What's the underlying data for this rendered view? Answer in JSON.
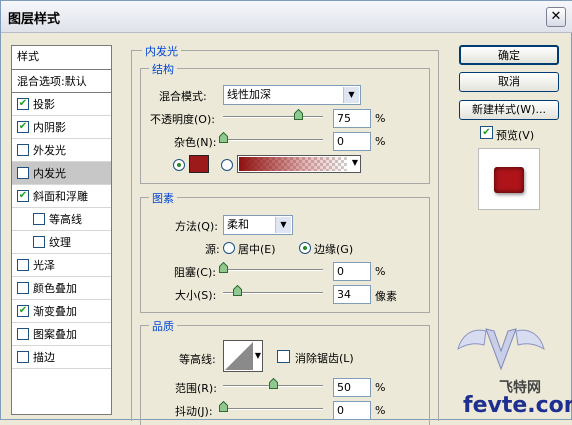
{
  "window": {
    "title": "图层样式",
    "close_glyph": "✕"
  },
  "sidebar": {
    "header": "样式",
    "blend_options": "混合选项:默认",
    "items": [
      {
        "label": "投影",
        "checked": true,
        "indent": 0,
        "selected": false
      },
      {
        "label": "内阴影",
        "checked": true,
        "indent": 0,
        "selected": false
      },
      {
        "label": "外发光",
        "checked": false,
        "indent": 0,
        "selected": false
      },
      {
        "label": "内发光",
        "checked": false,
        "indent": 0,
        "selected": true
      },
      {
        "label": "斜面和浮雕",
        "checked": true,
        "indent": 0,
        "selected": false
      },
      {
        "label": "等高线",
        "checked": false,
        "indent": 1,
        "selected": false
      },
      {
        "label": "纹理",
        "checked": false,
        "indent": 1,
        "selected": false
      },
      {
        "label": "光泽",
        "checked": false,
        "indent": 0,
        "selected": false
      },
      {
        "label": "颜色叠加",
        "checked": false,
        "indent": 0,
        "selected": false
      },
      {
        "label": "渐变叠加",
        "checked": true,
        "indent": 0,
        "selected": false
      },
      {
        "label": "图案叠加",
        "checked": false,
        "indent": 0,
        "selected": false
      },
      {
        "label": "描边",
        "checked": false,
        "indent": 0,
        "selected": false
      }
    ]
  },
  "panel": {
    "title": "内发光",
    "structure": {
      "legend": "结构",
      "blend_mode_label": "混合模式:",
      "blend_mode_value": "线性加深",
      "opacity_label": "不透明度(O):",
      "opacity_value": "75",
      "opacity_level": 0.75,
      "noise_label": "杂色(N):",
      "noise_value": "0",
      "noise_level": 0,
      "percent": "%",
      "color": "#9c1a1a"
    },
    "elements": {
      "legend": "图素",
      "method_label": "方法(Q):",
      "method_value": "柔和",
      "source_label": "源:",
      "source_center": "居中(E)",
      "source_edge": "边缘(G)",
      "source_selected": "edge",
      "choke_label": "阻塞(C):",
      "choke_value": "0",
      "choke_level": 0,
      "size_label": "大小(S):",
      "size_value": "34",
      "size_level": 0.136,
      "pixel_unit": "像素",
      "percent": "%"
    },
    "quality": {
      "legend": "品质",
      "contour_label": "等高线:",
      "anti_alias_label": "消除锯齿(L)",
      "anti_alias_checked": false,
      "range_label": "范围(R):",
      "range_value": "50",
      "range_level": 0.5,
      "jitter_label": "抖动(J):",
      "jitter_value": "0",
      "jitter_level": 0,
      "percent": "%"
    }
  },
  "buttons": {
    "ok": "确定",
    "cancel": "取消",
    "new_style": "新建样式(W)..."
  },
  "preview": {
    "label": "预览(V)",
    "checked": true,
    "swatch_color": "#b0141a"
  },
  "watermark": {
    "site": "飞特网",
    "url": "fevte.com"
  }
}
